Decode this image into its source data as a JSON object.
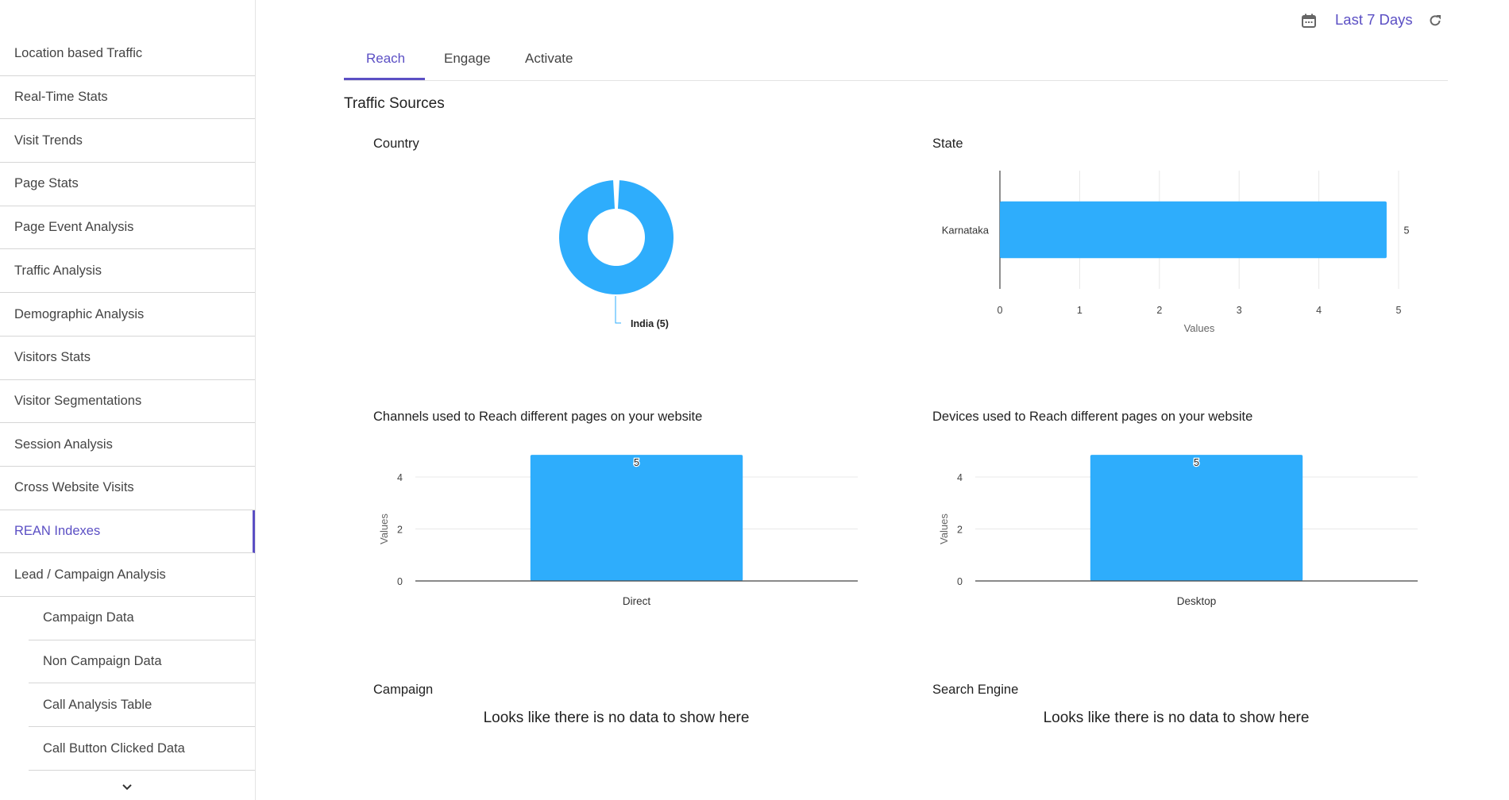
{
  "sidebar": {
    "items": [
      {
        "label": "Location based Traffic",
        "sub": false,
        "active": false
      },
      {
        "label": "Real-Time Stats",
        "sub": false,
        "active": false
      },
      {
        "label": "Visit Trends",
        "sub": false,
        "active": false
      },
      {
        "label": "Page Stats",
        "sub": false,
        "active": false
      },
      {
        "label": "Page Event Analysis",
        "sub": false,
        "active": false
      },
      {
        "label": "Traffic Analysis",
        "sub": false,
        "active": false
      },
      {
        "label": "Demographic Analysis",
        "sub": false,
        "active": false
      },
      {
        "label": "Visitors Stats",
        "sub": false,
        "active": false
      },
      {
        "label": "Visitor Segmentations",
        "sub": false,
        "active": false
      },
      {
        "label": "Session Analysis",
        "sub": false,
        "active": false
      },
      {
        "label": "Cross Website Visits",
        "sub": false,
        "active": false
      },
      {
        "label": "REAN Indexes",
        "sub": false,
        "active": true
      },
      {
        "label": "Lead / Campaign Analysis",
        "sub": false,
        "active": false
      },
      {
        "label": "Campaign Data",
        "sub": true,
        "active": false
      },
      {
        "label": "Non Campaign Data",
        "sub": true,
        "active": false
      },
      {
        "label": "Call Analysis Table",
        "sub": true,
        "active": false
      },
      {
        "label": "Call Button Clicked Data",
        "sub": true,
        "active": false
      }
    ],
    "more_icon": "chevron-down-icon"
  },
  "topbar": {
    "calendar_icon": "calendar-icon",
    "date_range": "Last 7 Days",
    "refresh_icon": "refresh-icon"
  },
  "tabs": [
    {
      "label": "Reach",
      "active": true
    },
    {
      "label": "Engage",
      "active": false
    },
    {
      "label": "Activate",
      "active": false
    }
  ],
  "section_title": "Traffic Sources",
  "colors": {
    "accent": "#5b4fc4",
    "bar": "#2eadfc",
    "text": "#333333"
  },
  "cards": {
    "country": {
      "title": "Country"
    },
    "state": {
      "title": "State"
    },
    "channels": {
      "title": "Channels used to Reach different pages on your website"
    },
    "devices": {
      "title": "Devices used to Reach different pages on your website"
    },
    "campaign": {
      "title": "Campaign",
      "empty_message": "Looks like there is no data to show here"
    },
    "search_engine": {
      "title": "Search Engine",
      "empty_message": "Looks like there is no data to show here"
    }
  },
  "chart_data": [
    {
      "id": "country",
      "type": "pie",
      "title": "Country",
      "donut": true,
      "categories": [
        "India"
      ],
      "values": [
        5
      ],
      "labels": [
        "India (5)"
      ]
    },
    {
      "id": "state",
      "type": "bar",
      "orientation": "horizontal",
      "title": "State",
      "categories": [
        "Karnataka"
      ],
      "values": [
        5
      ],
      "data_labels": [
        "5"
      ],
      "xlabel": "Values",
      "ylabel": "",
      "xlim": [
        0,
        5
      ],
      "xticks": [
        "0",
        "1",
        "2",
        "3",
        "4",
        "5"
      ],
      "grid": true
    },
    {
      "id": "channels",
      "type": "bar",
      "title": "Channels used to Reach different pages on your website",
      "categories": [
        "Direct"
      ],
      "values": [
        5
      ],
      "data_labels": [
        "5"
      ],
      "xlabel": "",
      "ylabel": "Values",
      "ylim": [
        0,
        5
      ],
      "yticks": [
        "0",
        "2",
        "4"
      ],
      "grid": true
    },
    {
      "id": "devices",
      "type": "bar",
      "title": "Devices used to Reach different pages on your website",
      "categories": [
        "Desktop"
      ],
      "values": [
        5
      ],
      "data_labels": [
        "5"
      ],
      "xlabel": "",
      "ylabel": "Values",
      "ylim": [
        0,
        5
      ],
      "yticks": [
        "0",
        "2",
        "4"
      ],
      "grid": true
    }
  ]
}
